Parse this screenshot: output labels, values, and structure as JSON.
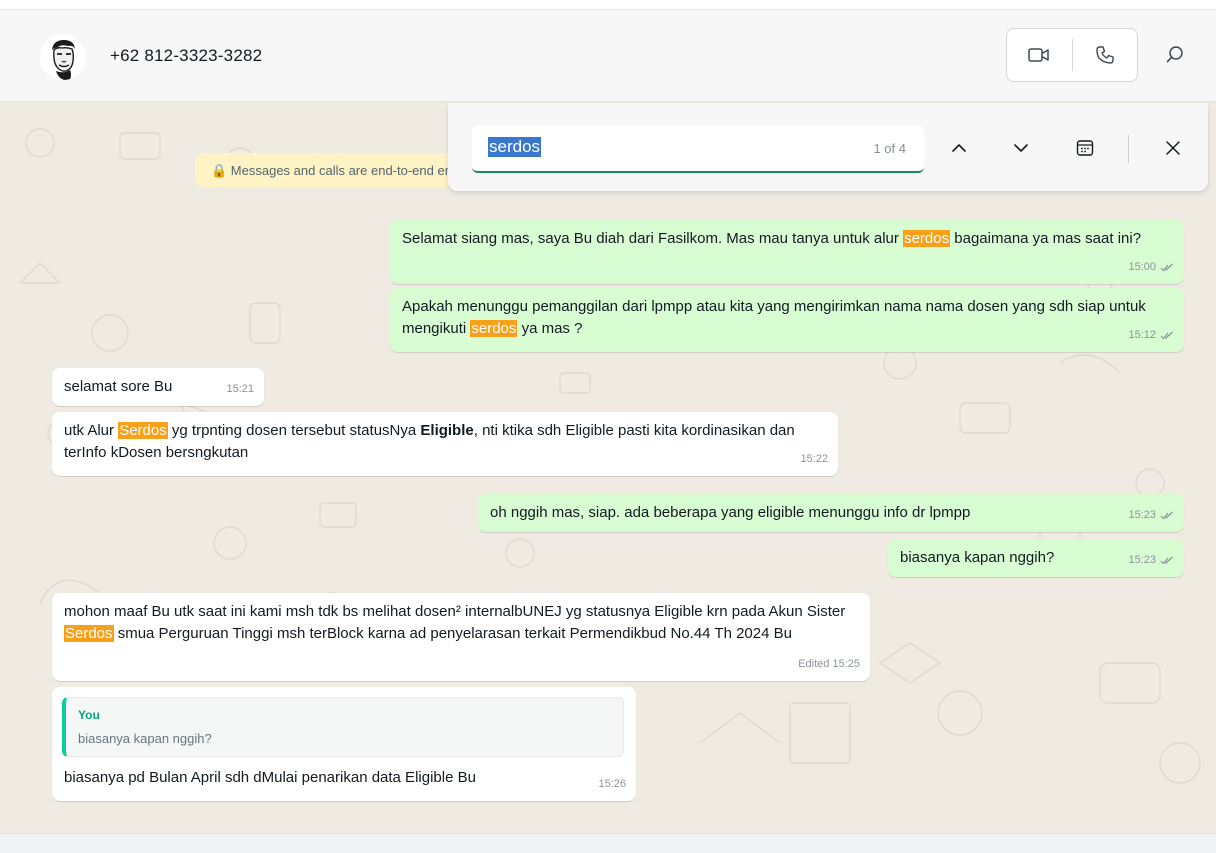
{
  "header": {
    "contact_name": "+62 812-3323-3282",
    "video_call_icon": "video-camera-icon",
    "voice_call_icon": "phone-icon",
    "search_icon": "search-icon"
  },
  "encryption_notice": "🔒 Messages and calls are end-to-end encrypted",
  "search": {
    "query": "serdos",
    "count": "1 of 4",
    "prev_icon": "chevron-up-icon",
    "next_icon": "chevron-down-icon",
    "date_icon": "calendar-icon",
    "close_icon": "close-icon"
  },
  "messages": [
    {
      "dir": "out",
      "parts": [
        "Selamat siang mas, saya Bu diah dari Fasilkom. Mas mau tanya untuk alur ",
        "serdos",
        " bagaimana ya mas saat ini?"
      ],
      "time": "15:00"
    },
    {
      "dir": "out",
      "parts": [
        "Apakah menunggu pemanggilan dari lpmpp atau kita yang mengirimkan nama nama dosen yang sdh siap untuk mengikuti ",
        "serdos",
        " ya mas ?"
      ],
      "time": "15:12"
    },
    {
      "dir": "in",
      "text": "selamat sore Bu",
      "time": "15:21"
    },
    {
      "dir": "in",
      "parts": [
        "utk Alur ",
        "Serdos",
        " yg trpnting dosen tersebut statusNya ",
        "Eligible",
        ", nti ktika sdh Eligible pasti kita kordinasikan dan terInfo kDosen bersngkutan"
      ],
      "time": "15:22"
    },
    {
      "dir": "out",
      "text": "oh nggih mas, siap. ada beberapa yang eligible menunggu info dr lpmpp",
      "time": "15:23"
    },
    {
      "dir": "out",
      "text": "biasanya kapan nggih?",
      "time": "15:23"
    },
    {
      "dir": "in",
      "parts": [
        "mohon maaf Bu utk saat ini kami msh tdk bs melihat dosen² internalbUNEJ yg statusnya Eligible krn pada Akun Sister ",
        "Serdos",
        " smua Perguruan Tinggi msh terBlock karna ad penyelarasan terkait Permendikbud No.44 Th 2024 Bu"
      ],
      "time": "Edited 15:25"
    },
    {
      "dir": "in",
      "quote_author": "You",
      "quote_text": "biasanya kapan nggih?",
      "text": "biasanya pd Bulan April sdh dMulai penarikan data Eligible Bu",
      "time": "15:26"
    }
  ]
}
